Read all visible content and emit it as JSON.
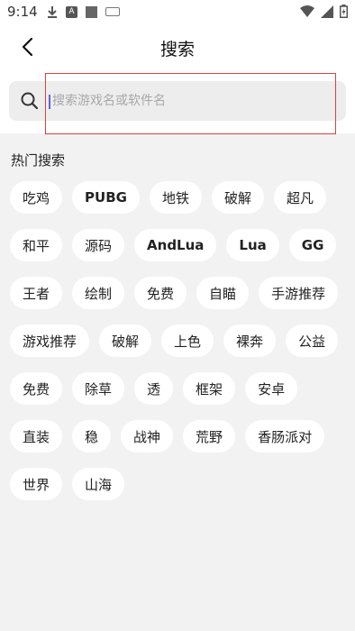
{
  "status_bar": {
    "time": "9:14",
    "left_icons": [
      "download-icon",
      "a-box-icon",
      "square-icon",
      "keyboard-icon"
    ],
    "right_icons": [
      "wifi-icon",
      "signal-icon",
      "battery-icon"
    ],
    "a_box_letter": "A"
  },
  "header": {
    "title": "搜索"
  },
  "search": {
    "placeholder": "搜索游戏名或软件名",
    "value": ""
  },
  "hot": {
    "title": "热门搜索",
    "rows": [
      [
        "吃鸡",
        "PUBG",
        "地铁",
        "破解",
        "超凡"
      ],
      [
        "和平",
        "源码",
        "AndLua",
        "Lua",
        "GG"
      ],
      [
        "王者",
        "绘制",
        "免费",
        "自瞄",
        "手游推荐"
      ],
      [
        "游戏推荐",
        "破解",
        "上色",
        "裸奔",
        "公益"
      ],
      [
        "免费",
        "除草",
        "透",
        "框架",
        "安卓"
      ],
      [
        "直装",
        "稳",
        "战神",
        "荒野",
        "香肠派对"
      ],
      [
        "世界",
        "山海"
      ]
    ]
  },
  "colors": {
    "accent_caret": "#6c5ce7",
    "highlight_border": "#d9423f",
    "background": "#f2f2f2",
    "tag_background": "#ffffff"
  }
}
